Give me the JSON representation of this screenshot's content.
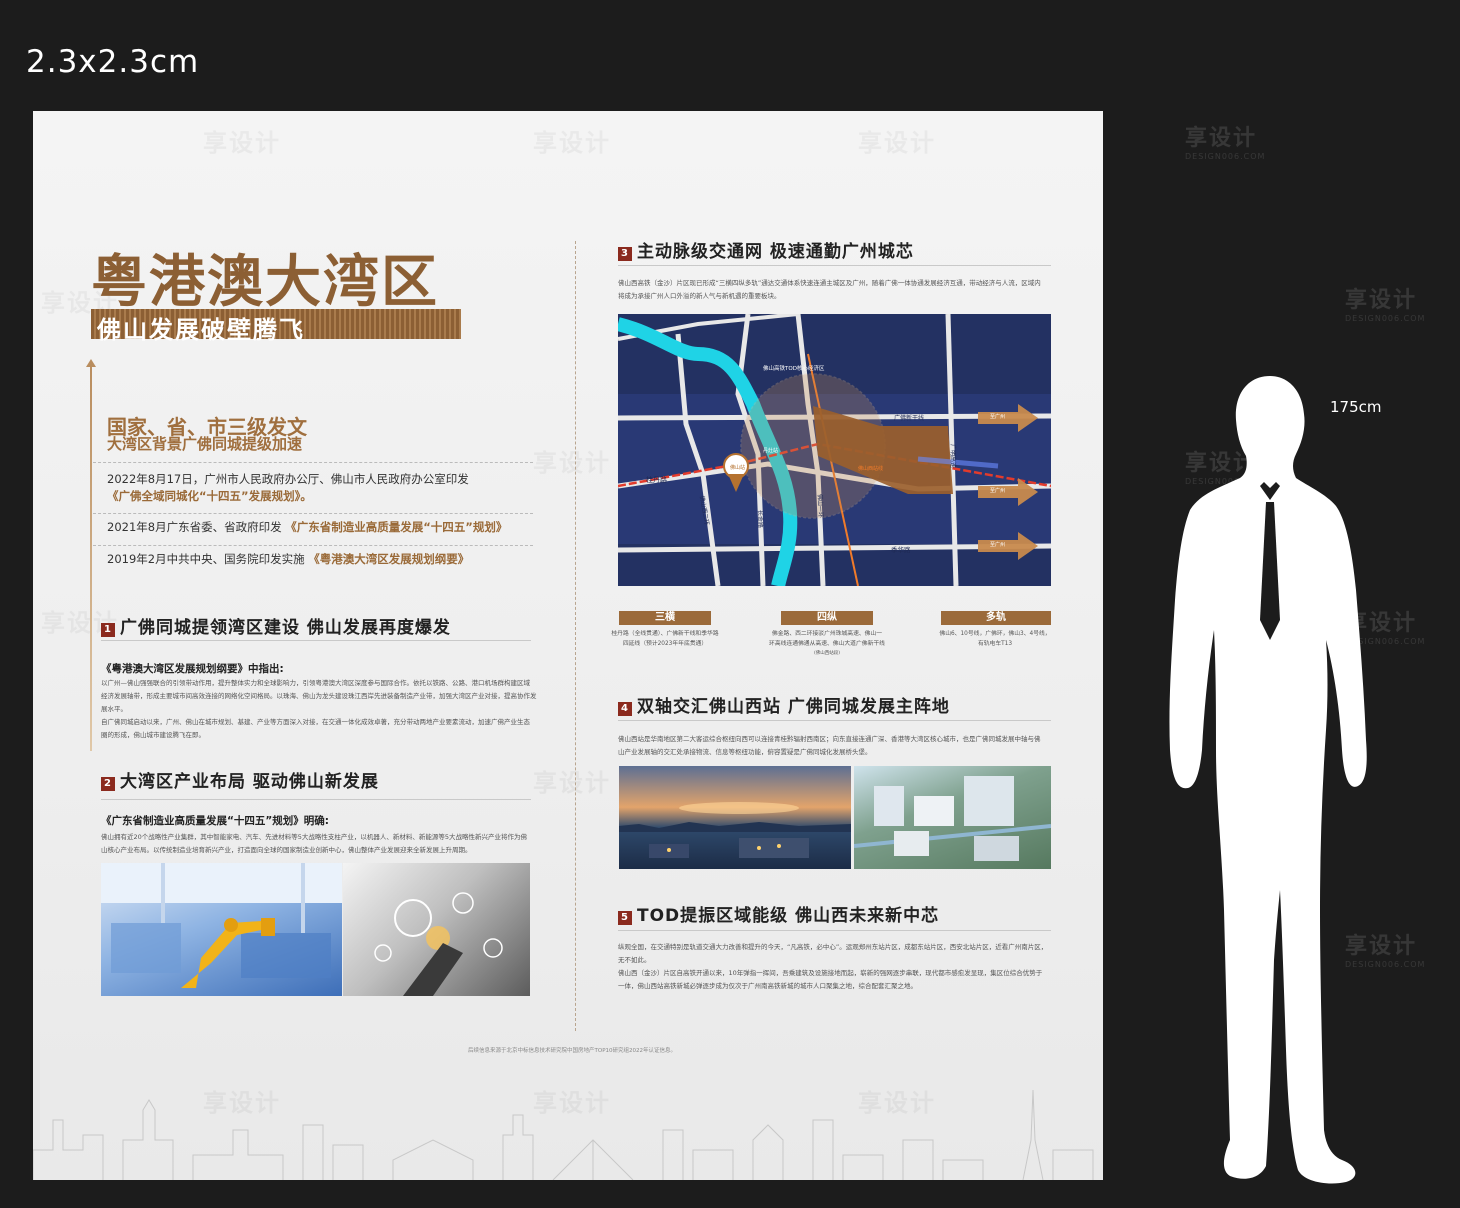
{
  "size_label": "2.3x2.3cm",
  "person_height": "175cm",
  "watermark": {
    "text": "享设计",
    "sub": "DESIGN006.COM"
  },
  "title": {
    "main": "粤港澳大湾区",
    "sub": "佛山发展破壁腾飞"
  },
  "kicker": {
    "line1": "国家、省、市三级发文",
    "line2": "大湾区背景广佛同城提级加速"
  },
  "timeline": [
    {
      "text": "2022年8月17日，广州市人民政府办公厅、佛山市人民政府办公室印发",
      "highlight": "《广佛全域同城化“十四五”发展规划》。"
    },
    {
      "text": "2021年8月广东省委、省政府印发",
      "highlight": "《广东省制造业高质量发展“十四五”规划》"
    },
    {
      "text": "2019年2月中共中央、国务院印发实施",
      "highlight": "《粤港澳大湾区发展规划纲要》"
    }
  ],
  "sections": {
    "s1": {
      "num": "1",
      "title": "广佛同城提领湾区建设  佛山发展再度爆发",
      "lead": "《粤港澳大湾区发展规划纲要》中指出:",
      "body": [
        "以广州—佛山强强联合的引领带动作用，提升整体实力和全球影响力，引领粤港澳大湾区深度参与国际合作。依托以铁路、公路、港口机场群构建区域",
        "经济发展轴带，形成主要城市间高效连接的网络化空间格局。以珠海、佛山为龙头建设珠江西岸先进装备制造产业带，加强大湾区产业对接，提高协作发展水平。",
        "自广佛同城启动以来，广州、佛山在城市规划、基建、产业等方面深入对接，在交通一体化成效卓著，充分带动两地产业要素流动，加速广佛产业生态",
        "圈的形成，佛山城市建设腾飞在即。"
      ]
    },
    "s2": {
      "num": "2",
      "title": "大湾区产业布局  驱动佛山新发展",
      "lead": "《广东省制造业高质量发展“十四五”规划》明确:",
      "body": [
        "佛山拥有近20个战略性产业集群，其中智能家电、汽车、先进材料等5大战略性支柱产业，以机器人、新材料、新能源等5大战略性新兴产业将作为佛",
        "山核心产业布局。以传统制造业培育新兴产业，打造面向全球的国家制造业创新中心，佛山整体产业发展迎来全新发展上升周期。"
      ]
    },
    "s3": {
      "num": "3",
      "title": "主动脉级交通网  极速通勤广州城芯",
      "body": [
        "佛山西高铁（金沙）片区现已形成“三横四纵多轨”通达交通体系快速连通主城区及广州，随着广佛一体协通发展经济互通，带动经济与人流，区域内",
        "将成为承接广州人口外溢的新人气与新机遇的重要板块。"
      ]
    },
    "s4": {
      "num": "4",
      "title": "双轴交汇佛山西站  广佛同城发展主阵地",
      "body": [
        "佛山西站是华南地区第二大客运综合枢纽向西可以连接青桂黔辐射西南区；向东直接连通广深、香港等大湾区核心城市，也是广佛同城发展中轴与佛",
        "山产业发展轴的交汇处承接物流、信息等枢纽功能，俯容置疑是广佛同城化发展桥头堡。"
      ]
    },
    "s5": {
      "num": "5",
      "title": "TOD提振区域能级  佛山西未来新中芯",
      "body": [
        "纵观全国，在交通特别是轨道交通大力改善和提升的今天，“凡高铁，必中心”。运观郑州东站片区，成都东站片区，西安北站片区，近看广州南片区，",
        "无不如此。",
        "佛山西（金沙）片区自高铁开通以来，10年弹指一挥间，吾乘建筑及设施接地而起，崭新的强网逐步串联，现代都市感愈发显现，集区位综合优势于",
        "一体，佛山西站高铁新城必弹逐步成为仅次于广州南高铁新城的城市人口聚集之地，综合配套汇聚之地。"
      ]
    }
  },
  "map_labels": {
    "ring": "佛山高铁TOD核心经济区",
    "guangfo": "广佛新干线",
    "guangming": "广明高速",
    "guidan": "桂丹路",
    "foshan2": "佛山西二环",
    "jinsha": "长金路",
    "foshan1": "佛山一环",
    "jihua": "季华路",
    "station": "佛山站",
    "danxiang": "丹灶站",
    "link": "佛山西站线",
    "east": "至广州",
    "east2": "至广州",
    "east3": "至广州",
    "east4": "至广州"
  },
  "tabs": [
    {
      "label": "三横",
      "desc": [
        "桂丹路（全线贯通）、广佛新干线和季华路",
        "四延线（预计2023年年底贯通）"
      ]
    },
    {
      "label": "四纵",
      "desc": [
        "佛金路、西二环接驳广州珠城高速、佛山一",
        "环高线连通佛通从高速、佛山大道广佛新干线",
        "(佛山西站段)"
      ]
    },
    {
      "label": "多轨",
      "desc": [
        "佛山6、10号线，广佛环，佛山3、4号线，",
        "有轨电车T13"
      ]
    }
  ],
  "footnote": "后续信息来源于北京中标信息技术研究院中国房地产TOP10研究组2022年认证信息。",
  "colors": {
    "brown": "#8c5f34",
    "accent_red": "#8b2a1e",
    "map_bg": "#22305e",
    "river": "#1fd3e6"
  }
}
